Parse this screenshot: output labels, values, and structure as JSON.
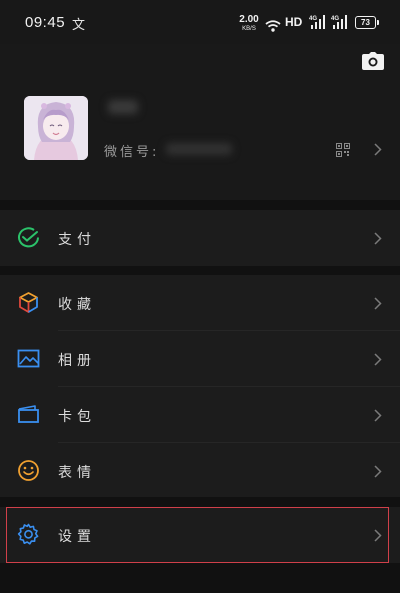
{
  "status_bar": {
    "time": "09:45",
    "app_icon": "文",
    "net_speed": "2.00",
    "net_speed_unit": "KB/S",
    "hd_label": "HD",
    "signal1_label": "4G",
    "signal2_label": "4G",
    "battery": "73"
  },
  "profile": {
    "wechat_id_label": "微信号:",
    "camera_icon": "camera-icon",
    "qr_icon": "qr-code-icon"
  },
  "menu": {
    "pay": {
      "label": "支付",
      "icon": "wechat-pay-icon",
      "color": "#2bc26a"
    },
    "favorites": {
      "label": "收藏",
      "icon": "cube-icon"
    },
    "album": {
      "label": "相册",
      "icon": "image-icon",
      "color": "#3a8ff0"
    },
    "cards": {
      "label": "卡包",
      "icon": "wallet-icon",
      "color": "#3a8ff0"
    },
    "stickers": {
      "label": "表情",
      "icon": "smile-icon",
      "color": "#f0a030"
    },
    "settings": {
      "label": "设置",
      "icon": "gear-icon",
      "color": "#3a8ff0"
    }
  },
  "highlight_color": "#d0404a"
}
